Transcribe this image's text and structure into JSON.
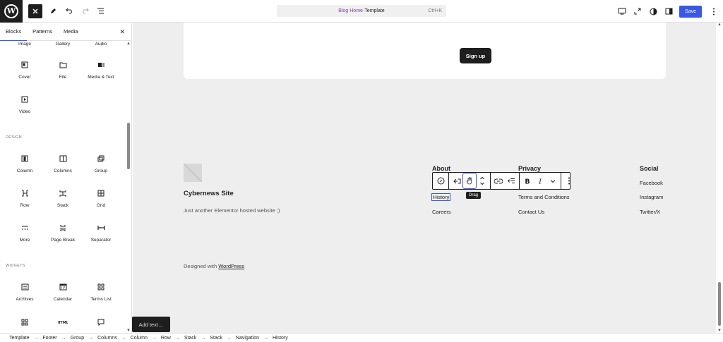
{
  "colors": {
    "accent": "#3858e9",
    "dark": "#1e1e1e",
    "canvas": "#eeeeee"
  },
  "topbar": {
    "doc_title_part1": "Blog Home",
    "doc_title_sep": " · ",
    "doc_title_part2": "Template",
    "shortcut": "Ctrl+K",
    "save_label": "Save"
  },
  "sidebar": {
    "tabs": [
      "Blocks",
      "Patterns",
      "Media"
    ],
    "partial_row": [
      "Image",
      "Gallery",
      "Audio"
    ],
    "media_blocks": [
      "Cover",
      "File",
      "Media & Text",
      "Video"
    ],
    "design_heading": "DESIGN",
    "design_blocks": [
      "Column",
      "Columns",
      "Group",
      "Row",
      "Stack",
      "Grid",
      "More",
      "Page Break",
      "Separator"
    ],
    "widgets_heading": "WIDGETS",
    "widget_blocks": [
      "Archives",
      "Calendar",
      "Terms List"
    ]
  },
  "canvas": {
    "signup_label": "Sign up",
    "site_title": "Cybernews Site",
    "site_tagline": "Just another Elementor hosted website ;)",
    "credit_prefix": "Designed with ",
    "credit_link": "WordPress",
    "columns": [
      {
        "heading": "About",
        "links": [
          "History",
          "Careers"
        ]
      },
      {
        "heading": "Privacy",
        "links": [
          "Terms and Conditions",
          "Contact Us"
        ]
      },
      {
        "heading": "Social",
        "links": [
          "Facebook",
          "Instagram",
          "Twitter/X"
        ]
      }
    ],
    "tooltip": "Drag",
    "add_text": "Add text…"
  },
  "breadcrumb": [
    "Template",
    "Footer",
    "Group",
    "Columns",
    "Column",
    "Row",
    "Stack",
    "Stack",
    "Navigation",
    "History"
  ]
}
